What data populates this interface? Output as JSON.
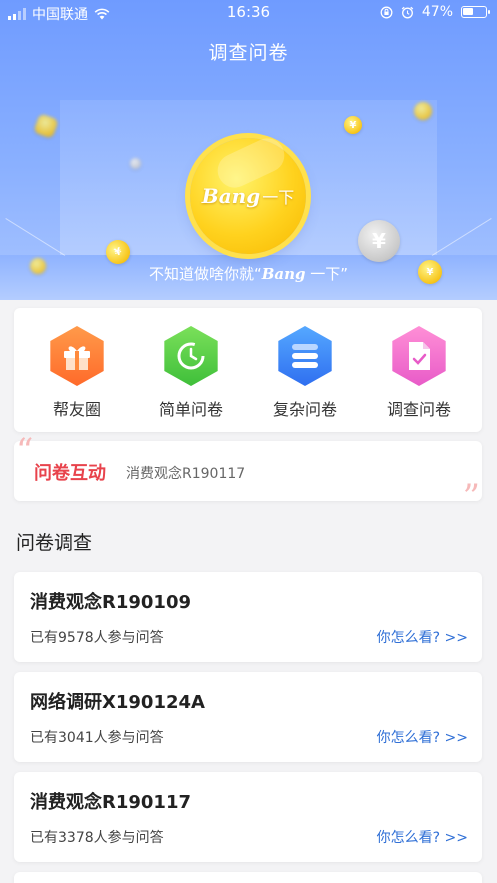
{
  "status_bar": {
    "carrier": "中国联通",
    "time": "16:36",
    "battery": "47%"
  },
  "header": {
    "title": "调查问卷"
  },
  "hero": {
    "coin_text_latin": "Bang",
    "coin_text_cn": "一下",
    "caption_prefix": "不知道做啥你就“",
    "caption_brand": "Bang",
    "caption_suffix": " 一下”"
  },
  "categories": [
    {
      "label": "帮友圈",
      "icon": "gift-icon",
      "color": "#ff7a35"
    },
    {
      "label": "简单问卷",
      "icon": "clock-icon",
      "color": "#4cc940"
    },
    {
      "label": "复杂问卷",
      "icon": "stack-icon",
      "color": "#3f86f7"
    },
    {
      "label": "调查问卷",
      "icon": "document-check-icon",
      "color": "#ee6fd0"
    }
  ],
  "interaction": {
    "title": "问卷互动",
    "subtitle": "消费观念R190117"
  },
  "surveys_section": {
    "title": "问卷调查",
    "items": [
      {
        "title": "消费观念R190109",
        "count": "已有9578人参与问答",
        "link": "你怎么看? >>"
      },
      {
        "title": "网络调研X190124A",
        "count": "已有3041人参与问答",
        "link": "你怎么看? >>"
      },
      {
        "title": "消费观念R190117",
        "count": "已有3378人参与问答",
        "link": "你怎么看? >>"
      }
    ]
  },
  "colors": {
    "accent": "#2f6fd6",
    "highlight": "#e8434c",
    "hero_blue": "#6f9bff"
  }
}
